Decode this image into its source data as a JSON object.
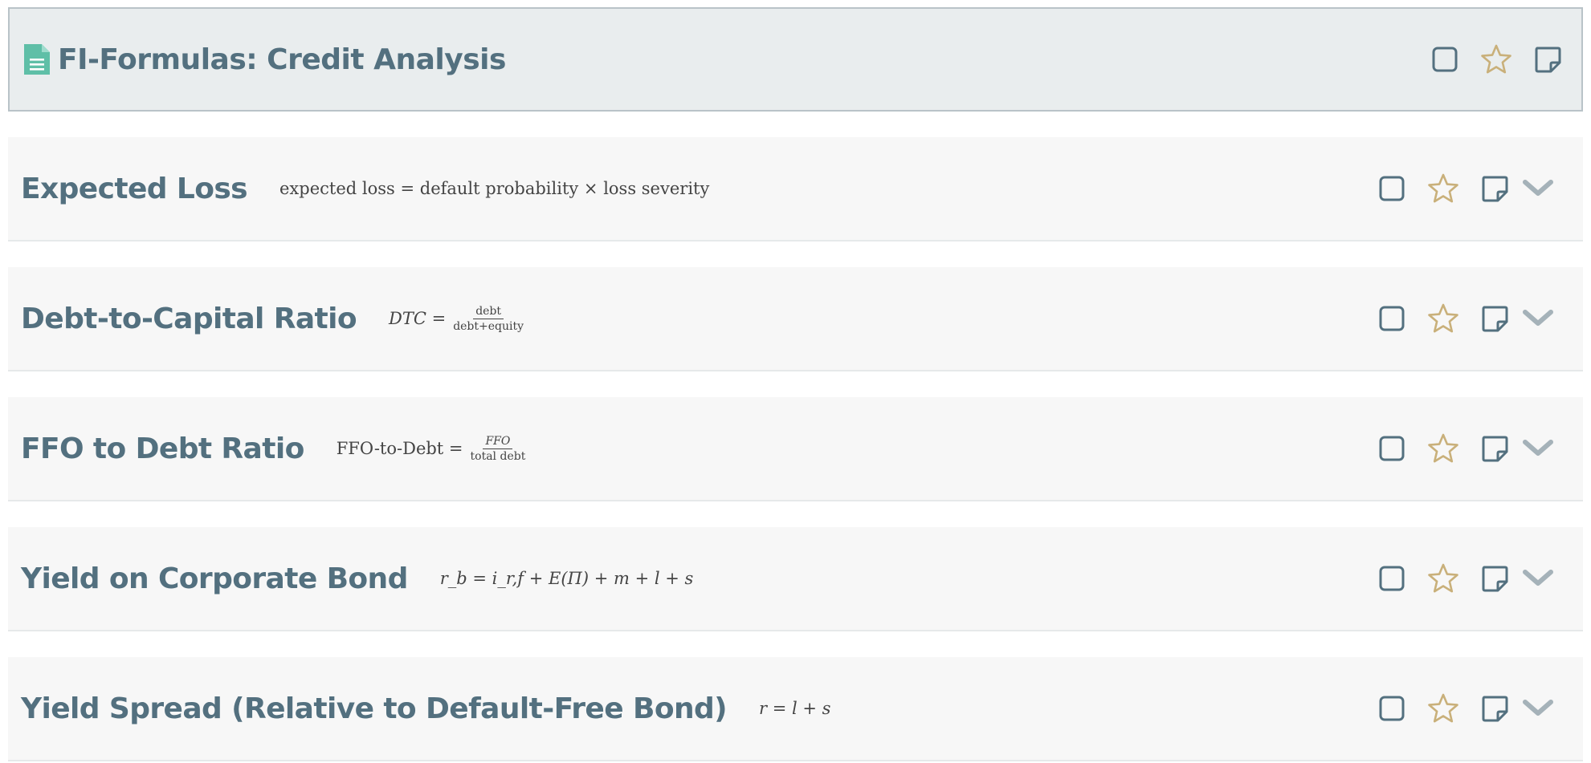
{
  "header": {
    "title": "FI-Formulas: Credit Analysis",
    "icons": [
      "document-icon",
      "checkbox-icon",
      "star-icon",
      "note-icon"
    ]
  },
  "colors": {
    "title": "#53707f",
    "star": "#c9b07a",
    "icon": "#53707f",
    "chevron": "#a5b2b9",
    "doc_icon": "#5fbfa7",
    "header_bg": "#e9edee",
    "card_bg": "#f7f7f7"
  },
  "formulas": [
    {
      "title": "Expected Loss",
      "formula_text": "expected loss = default probability × loss severity"
    },
    {
      "title": "Debt-to-Capital Ratio",
      "lhs": "DTC =",
      "numerator": "debt",
      "denominator": "debt+equity"
    },
    {
      "title": "FFO to Debt Ratio",
      "lhs": "FFO-to-Debt =",
      "numerator": "FFO",
      "denominator": "total debt"
    },
    {
      "title": "Yield on Corporate Bond",
      "formula_text": "r_b = i_r,f + E(Π) + m + l + s"
    },
    {
      "title": "Yield Spread (Relative to Default-Free Bond)",
      "formula_text": "r = l + s"
    }
  ]
}
